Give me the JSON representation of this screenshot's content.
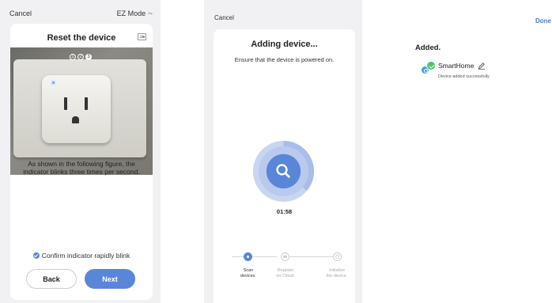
{
  "reset_screen": {
    "cancel_label": "Cancel",
    "mode_label": "EZ Mode",
    "mode_icon": "swap-arrows-icon",
    "title": "Reset the device",
    "guide_icon": "guide-card-icon",
    "steps": [
      "1",
      "2",
      "3"
    ],
    "description": "As shown in the following figure, the indicator blinks three times per second.",
    "confirm_label": "Confirm indicator rapidly blink",
    "confirm_checked": true,
    "back_label": "Back",
    "next_label": "Next",
    "accent_color": "#5a86d8"
  },
  "adding_screen": {
    "cancel_label": "Cancel",
    "title": "Adding device...",
    "subtitle": "Ensure that the device is powered on.",
    "search_icon": "search-icon",
    "timer": "01:58",
    "progress_steps": [
      {
        "line1": "Scan",
        "line2": "devices.",
        "active": true,
        "icon": "scan-dot-icon"
      },
      {
        "line1": "Register",
        "line2": "on Cloud.",
        "active": false,
        "icon": "cloud-icon"
      },
      {
        "line1": "Initialize",
        "line2": "the device.",
        "active": false,
        "icon": "device-init-icon"
      }
    ]
  },
  "added_screen": {
    "done_label": "Done",
    "heading": "Added.",
    "device": {
      "name": "SmartHome",
      "status": "Device added successfully",
      "icon": "device-icon",
      "badge_icon": "success-check-icon",
      "edit_icon": "pencil-icon",
      "badge_color": "#4cc36b",
      "icon_color": "#3ea0e6"
    }
  }
}
